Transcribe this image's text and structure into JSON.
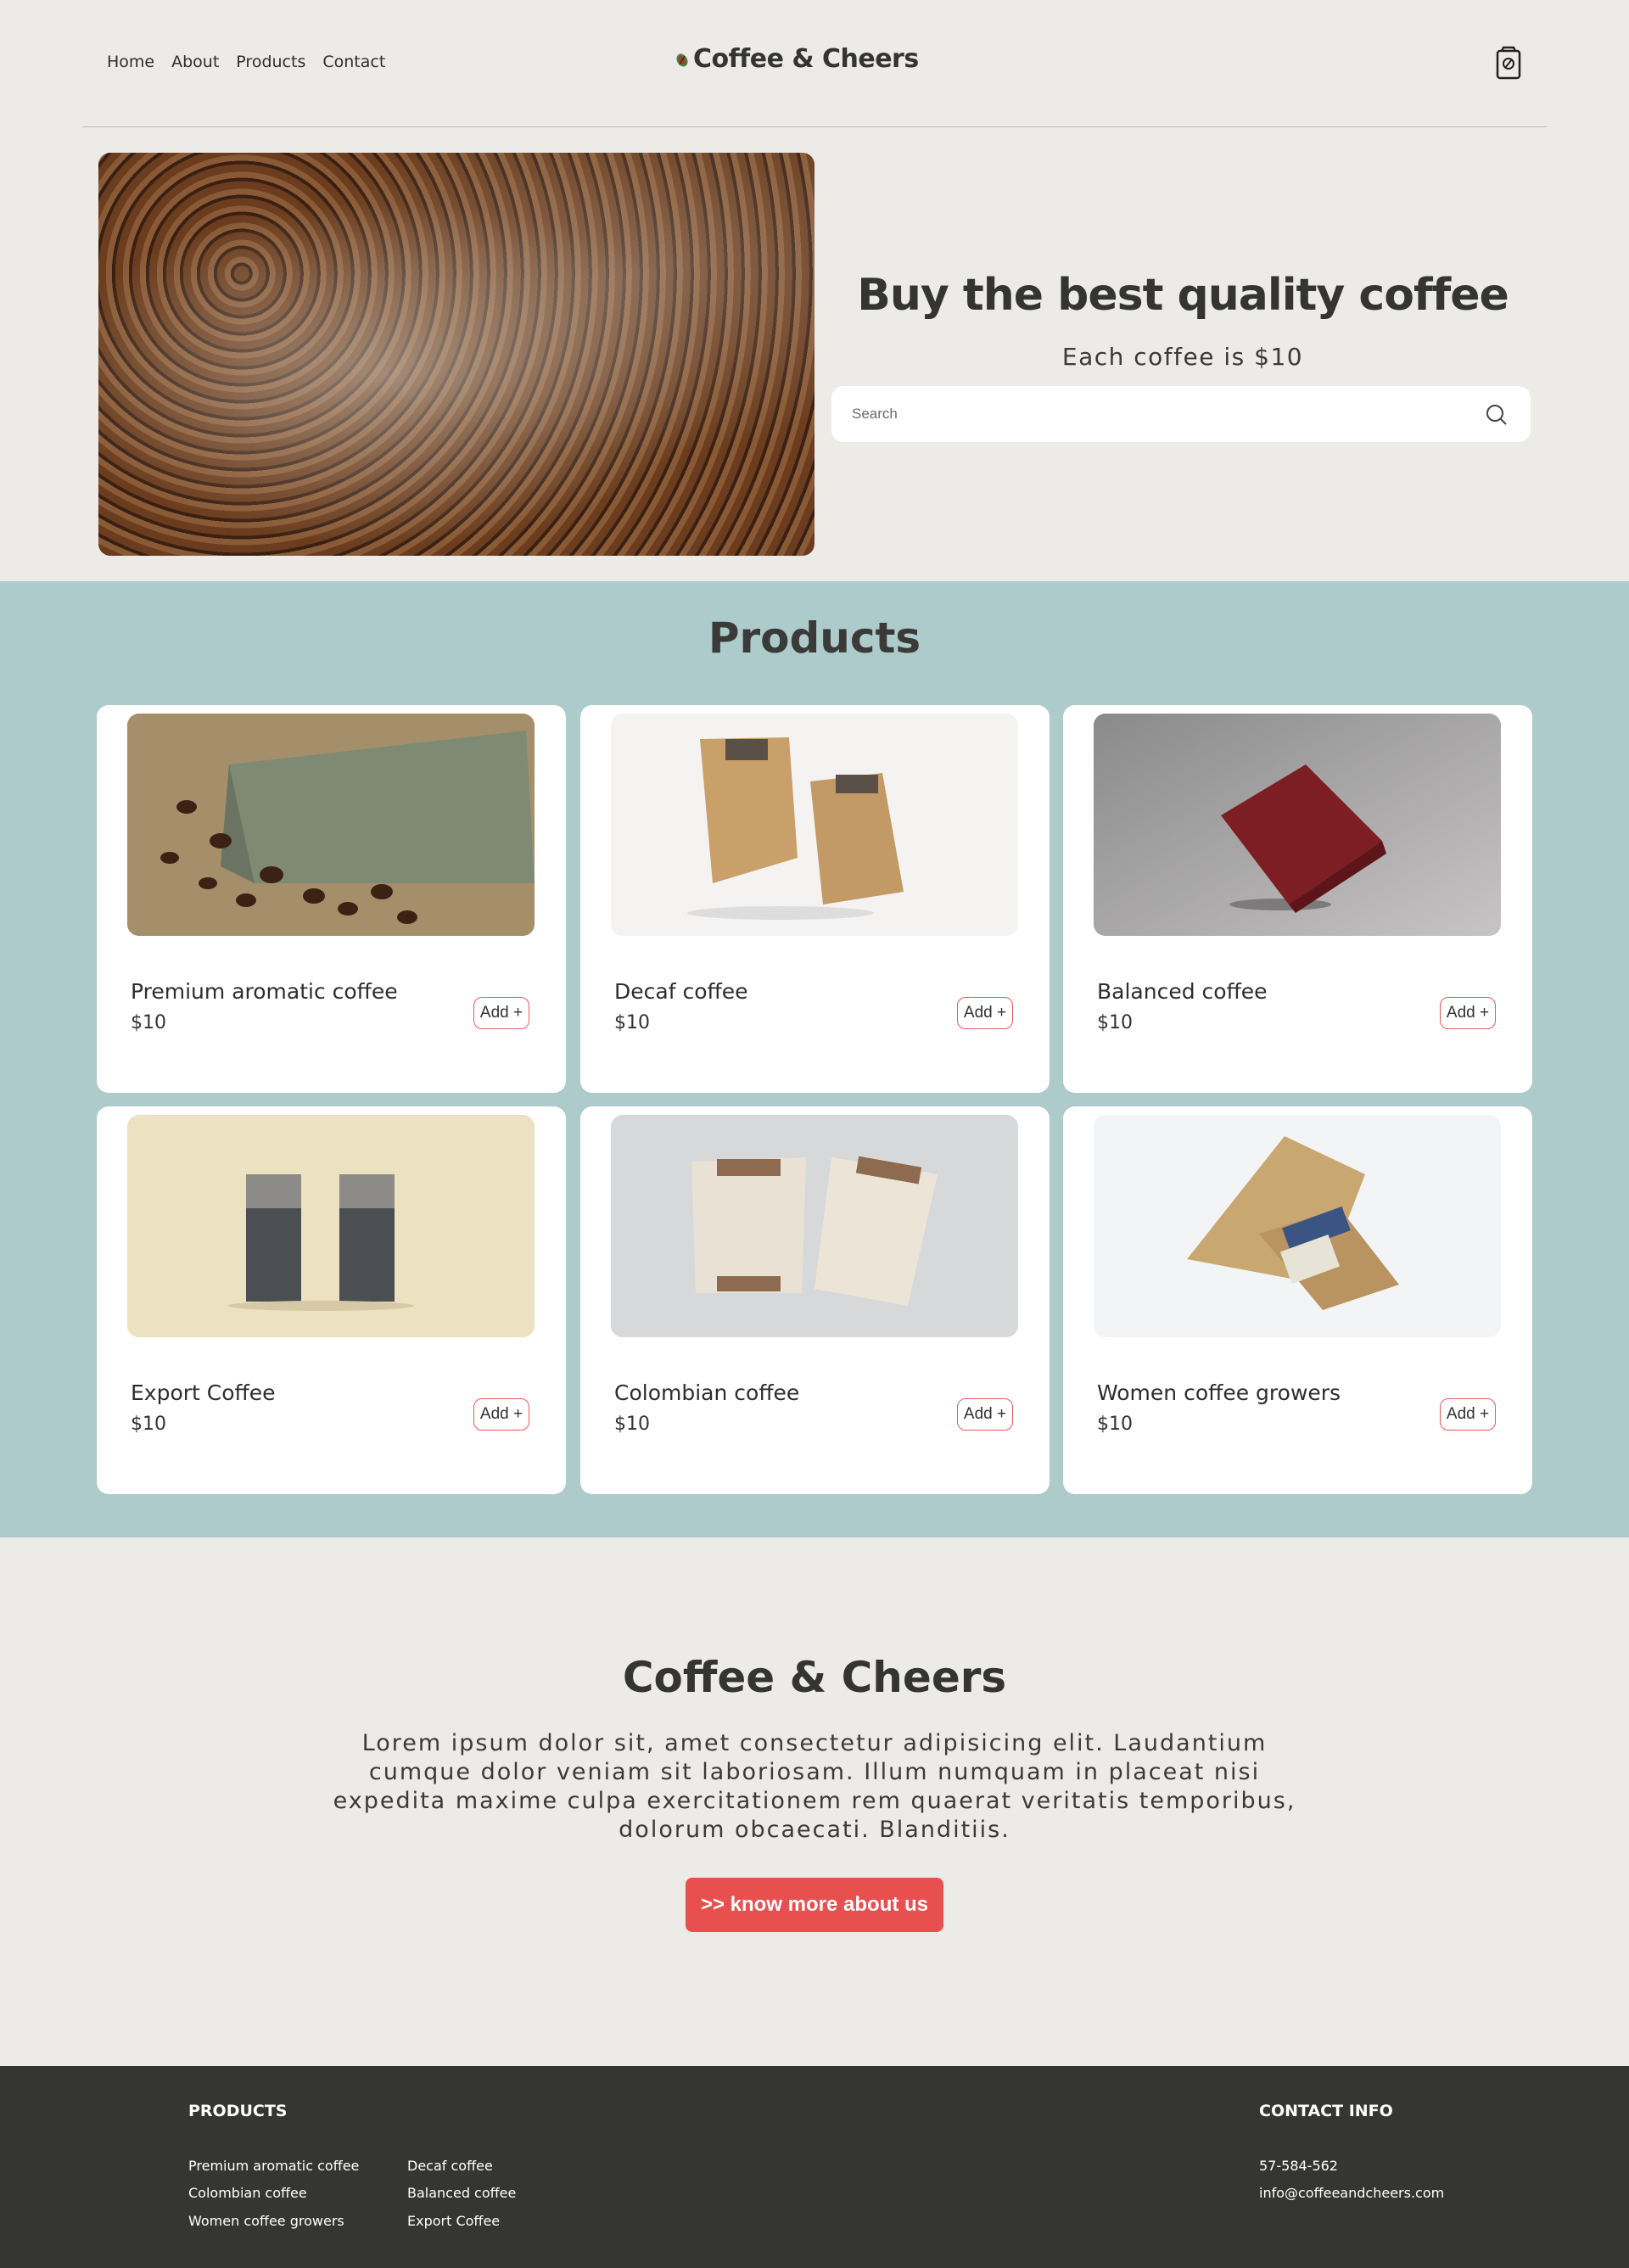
{
  "nav": {
    "home": "Home",
    "about": "About",
    "products": "Products",
    "contact": "Contact"
  },
  "brand": {
    "name": "Coffee & Cheers",
    "icon": "coffee-bean-icon",
    "accent": "#4a8a4a"
  },
  "cart": {
    "icon": "shopping-bag-icon"
  },
  "hero": {
    "title": "Buy the best quality coffee",
    "subtitle": "Each coffee is $10",
    "search_placeholder": "Search",
    "image": "coffee-beans-photo"
  },
  "products": {
    "title": "Products",
    "add_label": "Add +",
    "items": [
      {
        "name": "Premium aromatic coffee",
        "price": "$10",
        "image": "green-coffee-bag-photo"
      },
      {
        "name": "Decaf coffee",
        "price": "$10",
        "image": "kraft-coffee-bags-photo"
      },
      {
        "name": "Balanced coffee",
        "price": "$10",
        "image": "red-coffee-bag-photo"
      },
      {
        "name": "Export Coffee",
        "price": "$10",
        "image": "striped-coffee-bags-photo"
      },
      {
        "name": "Colombian coffee",
        "price": "$10",
        "image": "pouch-bags-photo"
      },
      {
        "name": "Women coffee growers",
        "price": "$10",
        "image": "kraft-pouch-photo"
      }
    ]
  },
  "about": {
    "title": "Coffee & Cheers",
    "text": "Lorem ipsum dolor sit, amet consectetur adipisicing elit. Laudantium cumque dolor veniam sit laboriosam. Illum numquam in placeat nisi expedita maxime culpa exercitationem rem quaerat veritatis temporibus, dolorum obcaecati. Blanditiis.",
    "button": ">> know more about us",
    "button_color": "#e84f4f"
  },
  "footer": {
    "products_heading": "PRODUCTS",
    "col1": [
      "Premium aromatic coffee",
      "Colombian coffee",
      "Women coffee growers"
    ],
    "col2": [
      "Decaf coffee",
      "Balanced coffee",
      "Export Coffee"
    ],
    "contact_heading": "CONTACT INFO",
    "phone": "57-584-562",
    "email": "info@coffeeandcheers.com"
  },
  "colors": {
    "background": "#ecebe8",
    "products_bg": "#adcbcb",
    "footer_bg": "#353532",
    "text": "#343432"
  }
}
